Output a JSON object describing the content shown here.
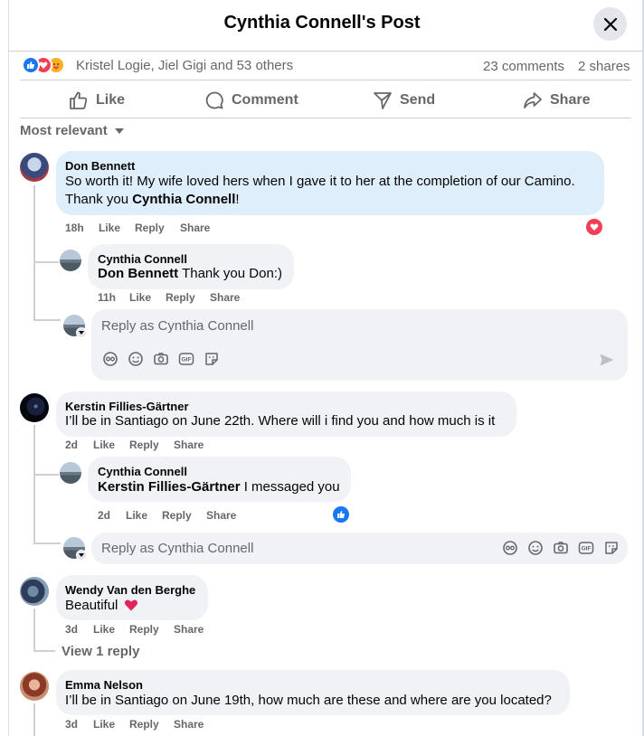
{
  "header": {
    "title": "Cynthia Connell's Post"
  },
  "reactions": {
    "names": "Kristel Logie, Jiel Gigi and 53 others",
    "comments": "23 comments",
    "shares": "2 shares"
  },
  "actions": {
    "like": "Like",
    "comment": "Comment",
    "send": "Send",
    "share": "Share"
  },
  "sort": {
    "label": "Most relevant"
  },
  "comments": [
    {
      "name": "Don Bennett",
      "line1": "So worth it! My wife loved hers when I gave it to her at the completion of our Camino.",
      "line2_prefix": "Thank you ",
      "line2_mention": "Cynthia Connell",
      "line2_suffix": "!",
      "time": "18h",
      "like": "Like",
      "reply": "Reply",
      "share": "Share",
      "reply_item": {
        "name": "Cynthia Connell",
        "mention": "Don Bennett",
        "text": " Thank you Don:)",
        "time": "11h",
        "like": "Like",
        "reply": "Reply",
        "share": "Share"
      }
    },
    {
      "name": "Kerstin Fillies-Gärtner",
      "text": "I’ll be in Santiago on June 22th. Where will i find you and how much is it",
      "time": "2d",
      "like": "Like",
      "reply": "Reply",
      "share": "Share",
      "reply_item": {
        "name": "Cynthia Connell",
        "mention": "Kerstin Fillies-Gärtner",
        "text": " I messaged you",
        "time": "2d",
        "like": "Like",
        "reply": "Reply",
        "share": "Share"
      }
    },
    {
      "name": "Wendy Van den Berghe",
      "text": "Beautiful",
      "time": "3d",
      "like": "Like",
      "reply": "Reply",
      "share": "Share",
      "view_replies": "View 1 reply"
    },
    {
      "name": "Emma Nelson",
      "text": "I’ll be in Santiago on June 19th, how much are these and where are you located?",
      "time": "3d",
      "like": "Like",
      "reply": "Reply",
      "share": "Share"
    }
  ],
  "reply_box": {
    "placeholder": "Reply as Cynthia Connell"
  },
  "colors": {
    "like_blue": "#1877f2",
    "love_red": "#f33e58",
    "care_yellow": "#f7b125",
    "bubble_blue": "#dfeefb",
    "bubble_grey": "#f0f2f5"
  },
  "icons": [
    "close-icon",
    "like-icon",
    "comment-icon",
    "send-icon",
    "share-icon",
    "caret-down-icon",
    "avatar-icon",
    "sticker-icon",
    "emoji-icon",
    "camera-icon",
    "gif-icon",
    "send-arrow-icon",
    "heart-reaction-icon",
    "thumb-reaction-icon"
  ]
}
